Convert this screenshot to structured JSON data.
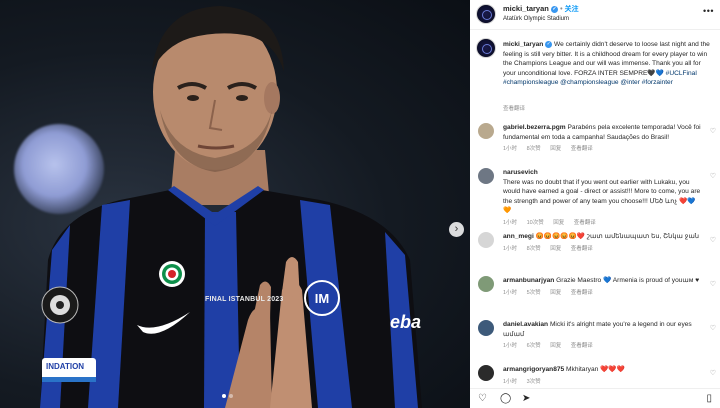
{
  "post": {
    "username": "micki_taryan",
    "verified_mark": "✓",
    "separator": "•",
    "follow_label": "关注",
    "location": "Atatürk Olympic Stadium",
    "more": "•••"
  },
  "caption": {
    "username": "micki_taryan",
    "text": "We certainly didn't deserve to loose last night and the feeling is still very bitter. It is a childhood dream for every player to win the Champions League and our will was immense. Thank you all for your unconditional love. FORZA INTER SEMPRE",
    "emoji": "🖤💙",
    "tags": "#UCLFinal #championsleague @championsleague @inter #forzainter",
    "meta": "查看翻译"
  },
  "comments": [
    {
      "username": "gabriel.bezerra.pgm",
      "text": "Parabéns pela excelente temporada! Você foi fundamental em toda a campanha! Saudações do Brasil!",
      "meta": [
        "1小时",
        "8次赞",
        "回复",
        "查看翻译"
      ],
      "avatar_color": "#b9a98e"
    },
    {
      "username": "narusevich",
      "text": "There was no doubt that if you went out earlier with Lukaku, you would have earned a goal - direct or assist!!! More to come, you are the strength and power of any team you choose!!! Մեծ ևոչ",
      "emoji": "❤️💙🧡",
      "meta": [
        "1小时",
        "10次赞",
        "回复",
        "查看翻译"
      ],
      "avatar_color": "#6e7784"
    },
    {
      "username": "ann_megi",
      "text": "😡😡😡😡😡❤️ շատ ամենապատ ես, Շնկա ջան",
      "meta": [
        "1小时",
        "8次赞",
        "回复",
        "查看翻译"
      ],
      "avatar_color": "#d6d6d6"
    },
    {
      "username": "armanbunarjyan",
      "text": "Grazie Maestro",
      "emoji": "💙",
      "text2": "Armenia is proud of youաм",
      "emoji2": "♥",
      "meta": [
        "1小时",
        "5次赞",
        "回复",
        "查看翻译"
      ],
      "avatar_color": "#7f9a77"
    },
    {
      "username": "daniel.avakian",
      "text": "Micki it's alright mate you're a legend in our eyes ամամ",
      "meta": [
        "1小时",
        "6次赞",
        "回复",
        "查看翻译"
      ],
      "avatar_color": "#3d5a7a"
    },
    {
      "username": "armangrigoryan875",
      "text": "Mkhitaryan",
      "emoji": "❤️❤️❤️",
      "meta": [
        "1小时",
        "3次赞",
        "回复",
        "查看翻译"
      ],
      "avatar_color": "#2b2b2b"
    }
  ],
  "photo": {
    "next_arrow": "›",
    "kit_text": "FINAL ISTANBUL 2023",
    "sponsor": "eba",
    "badge_text": "INDATION"
  },
  "icons": {
    "like": "heart-icon",
    "comment": "comment-icon",
    "share": "share-icon",
    "save": "bookmark-icon"
  },
  "colors": {
    "inter_blue": "#1f3fa6",
    "inter_black": "#0e0e12",
    "link": "#00376b",
    "follow": "#0095f6"
  }
}
